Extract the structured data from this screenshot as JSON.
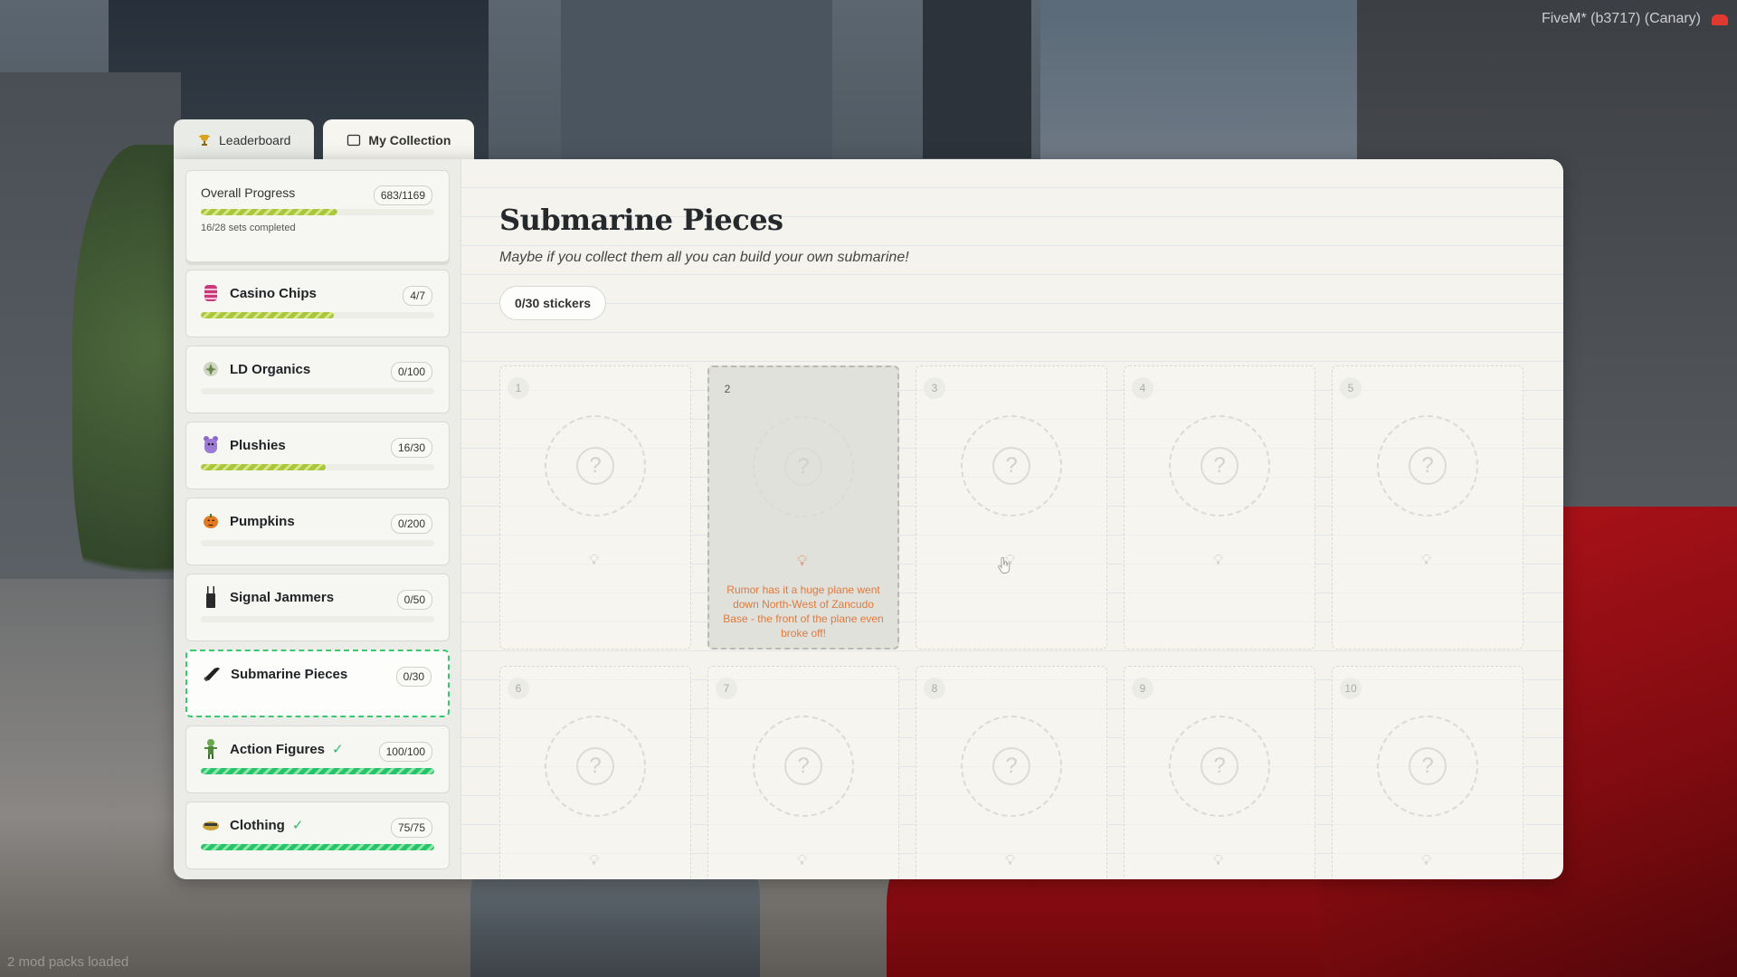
{
  "overlay": {
    "fivem_label": "FiveM* (b3717) (Canary)",
    "modpacks_label": "2 mod packs loaded"
  },
  "tabs": [
    {
      "label": "Leaderboard",
      "icon": "trophy-icon",
      "active": false
    },
    {
      "label": "My Collection",
      "icon": "collection-icon",
      "active": true
    }
  ],
  "overall": {
    "label": "Overall Progress",
    "count": "683/1169",
    "sub": "16/28 sets completed",
    "progress": 0.584
  },
  "categories": [
    {
      "name": "Casino Chips",
      "count": "4/7",
      "icon": "casino-chip-icon",
      "progress": 0.571,
      "complete": false
    },
    {
      "name": "LD Organics",
      "count": "0/100",
      "icon": "organics-leaf-icon",
      "progress": 0,
      "complete": false
    },
    {
      "name": "Plushies",
      "count": "16/30",
      "icon": "plushie-icon",
      "progress": 0.533,
      "complete": false
    },
    {
      "name": "Pumpkins",
      "count": "0/200",
      "icon": "pumpkin-icon",
      "progress": 0,
      "complete": false
    },
    {
      "name": "Signal Jammers",
      "count": "0/50",
      "icon": "signal-jammer-icon",
      "progress": 0,
      "complete": false
    },
    {
      "name": "Submarine Pieces",
      "count": "0/30",
      "icon": "submarine-piece-icon",
      "progress": 0,
      "complete": false,
      "selected": true
    },
    {
      "name": "Action Figures",
      "count": "100/100",
      "icon": "action-figure-icon",
      "progress": 1,
      "complete": true
    },
    {
      "name": "Clothing",
      "count": "75/75",
      "icon": "clothing-icon",
      "progress": 1,
      "complete": true
    }
  ],
  "collection": {
    "title": "Submarine Pieces",
    "subtitle": "Maybe if you collect them all you can build your own submarine!",
    "sticker_count": "0/30 stickers",
    "slots": [
      {
        "num": "1"
      },
      {
        "num": "2",
        "hint": "Rumor has it a huge plane went down North-West of Zancudo Base - the front of the plane even broke off!"
      },
      {
        "num": "3"
      },
      {
        "num": "4"
      },
      {
        "num": "5"
      },
      {
        "num": "6"
      },
      {
        "num": "7"
      },
      {
        "num": "8"
      },
      {
        "num": "9"
      },
      {
        "num": "10"
      }
    ]
  },
  "colors": {
    "accent_green": "#3ac86f",
    "progress_yellow": "#a8c73a",
    "hint_orange": "#e07a3e"
  }
}
